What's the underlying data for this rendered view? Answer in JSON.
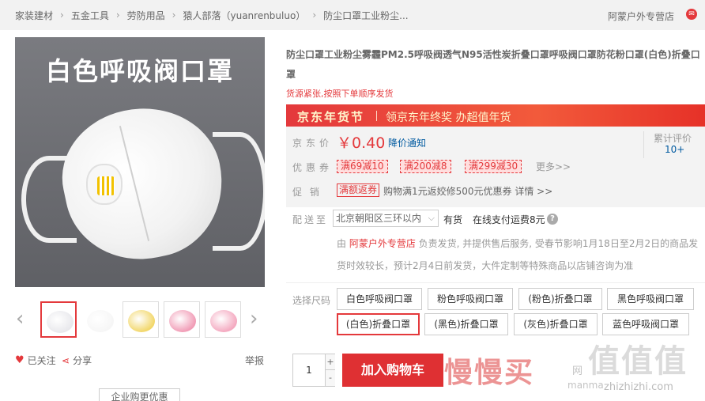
{
  "breadcrumb": {
    "items": [
      "家装建材",
      "五金工具",
      "劳防用品",
      "猿人部落（yuanrenbuluo）",
      "防尘口罩工业粉尘..."
    ],
    "separator": "›",
    "shop": "阿蒙户外专营店"
  },
  "gallery": {
    "main_image_caption": "白色呼吸阀口罩",
    "thumb_prev": "‹",
    "thumb_next": "›",
    "thumbnails": [
      {
        "name": "white-valve-mask",
        "color": "#e8e8ec"
      },
      {
        "name": "white-fold-mask",
        "color": "#f6f6f6"
      },
      {
        "name": "yellow-valve-mask",
        "color": "#f2d76a"
      },
      {
        "name": "pink-fold-mask",
        "color": "#f19cb6"
      },
      {
        "name": "pink-valve-mask",
        "color": "#f4a9c0"
      }
    ]
  },
  "actions": {
    "follow": "已关注",
    "share": "分享",
    "report": "举报",
    "corporate": "企业购更优惠"
  },
  "product": {
    "title": "防尘口罩工业粉尘雾霾PM2.5呼吸阀透气N95活性炭折叠口罩呼吸阀口罩防花粉口罩(白色)折叠口罩",
    "stock_note": "货源紧张,按照下单顺序发货"
  },
  "banner": {
    "main": "京东年货节",
    "sub": "领京东年终奖 办超值年货"
  },
  "price": {
    "label": "京东价",
    "value": "￥0.40",
    "notify": "降价通知",
    "review_label": "累计评价",
    "review_count": "10+"
  },
  "coupons": {
    "label": "优惠券",
    "items": [
      "满69减10",
      "满200减8",
      "满299减30"
    ],
    "more": "更多>>"
  },
  "promo": {
    "label": "促 销",
    "tag": "满额返券",
    "text": "购物满1元返姣修500元优惠券 详情 >>"
  },
  "shipping": {
    "label": "配送至",
    "address": "北京朝阳区三环以内",
    "in_stock": "有货",
    "pay_on_delivery": "在线支付运费8元",
    "delivery_prefix": "由 ",
    "seller": "阿蒙户外专营店",
    "delivery_text": " 负责发货, 并提供售后服务, 受春节影响1月18日至2月2日的商品发货时效较长，预计2月4日前发货，大件定制等特殊商品以店铺咨询为准"
  },
  "options": {
    "label": "选择尺码",
    "items": [
      "白色呼吸阀口罩",
      "粉色呼吸阀口罩",
      "(粉色)折叠口罩",
      "黑色呼吸阀口罩",
      "(白色)折叠口罩",
      "(黑色)折叠口罩",
      "(灰色)折叠口罩",
      "蓝色呼吸阀口罩"
    ],
    "selected_index": 4
  },
  "cart": {
    "quantity": "1",
    "plus": "+",
    "minus": "-",
    "add_label": "加入购物车"
  },
  "watermark": {
    "left": "慢慢买",
    "right": "值值值",
    "sub1": "网",
    "sub2": "manma",
    "sub3": "zhizhizhi.com"
  },
  "colors": {
    "accent": "#e4393c",
    "link": "#005aa0"
  }
}
